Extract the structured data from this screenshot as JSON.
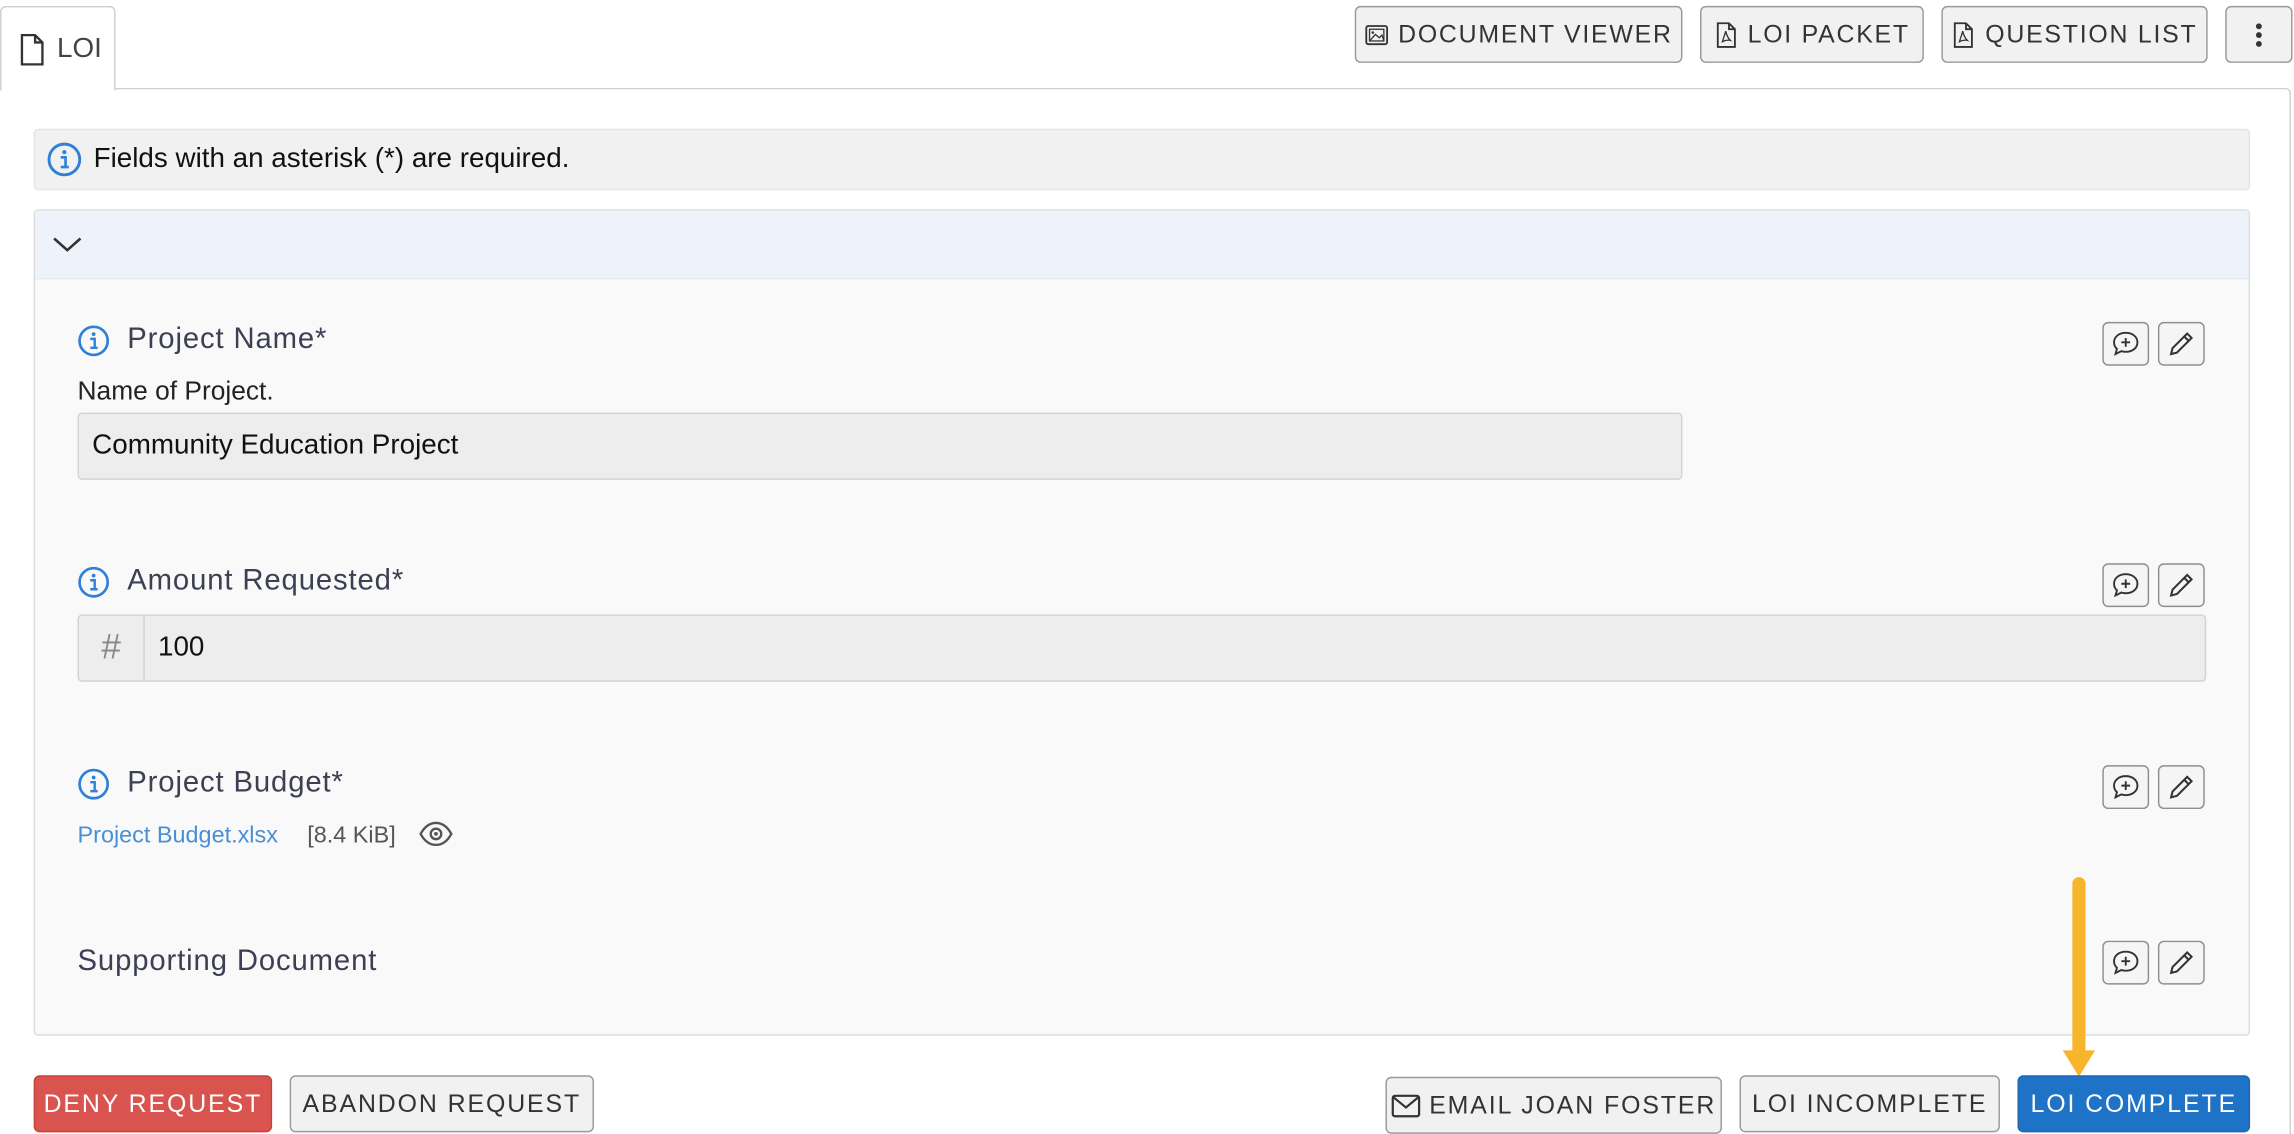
{
  "tab": {
    "label": "LOI",
    "icon": "document-icon"
  },
  "toolbar": {
    "document_viewer": "DOCUMENT VIEWER",
    "loi_packet": "LOI PACKET",
    "question_list": "QUESTION LIST",
    "more_icon": "kebab-menu-icon"
  },
  "banner": {
    "text": "Fields with an asterisk (*) are required."
  },
  "fields": {
    "project_name": {
      "label": "Project Name*",
      "description": "Name of Project.",
      "value": "Community Education Project"
    },
    "amount_requested": {
      "label": "Amount Requested*",
      "prefix": "#",
      "value": "100"
    },
    "project_budget": {
      "label": "Project Budget*",
      "file_name": "Project Budget.xlsx",
      "file_size": "[8.4 KiB]"
    },
    "supporting_document": {
      "label": "Supporting Document"
    }
  },
  "actions": {
    "deny": "DENY REQUEST",
    "abandon": "ABANDON REQUEST",
    "email": "EMAIL JOAN FOSTER",
    "incomplete": "LOI INCOMPLETE",
    "complete": "LOI COMPLETE"
  },
  "colors": {
    "accent_blue": "#1e73c7",
    "danger_red": "#d9534f",
    "info_blue": "#2f80d8",
    "arrow_yellow": "#f7b52c",
    "link_blue": "#4a8fd6"
  }
}
